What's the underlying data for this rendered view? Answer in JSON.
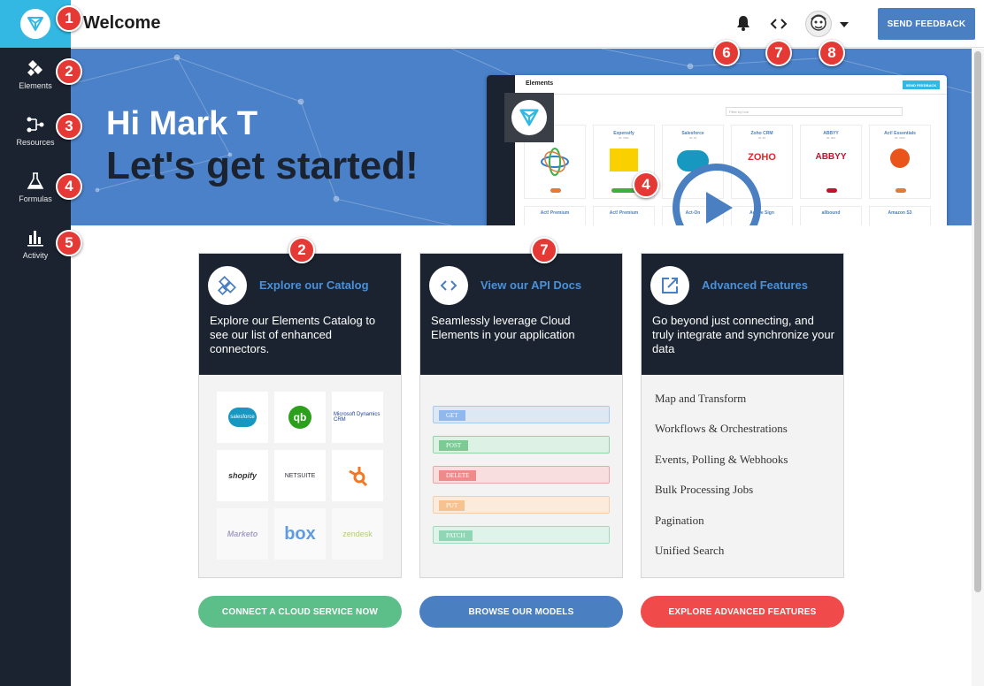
{
  "header": {
    "title": "Welcome",
    "feedback_label": "SEND FEEDBACK"
  },
  "sidebar": {
    "items": [
      {
        "label": "Elements",
        "icon": "elements-icon"
      },
      {
        "label": "Resources",
        "icon": "resources-icon"
      },
      {
        "label": "Formulas",
        "icon": "formulas-icon"
      },
      {
        "label": "Activity",
        "icon": "activity-icon"
      }
    ]
  },
  "hero": {
    "greeting": "Hi Mark T",
    "headline": "Let's get started!",
    "preview": {
      "title": "Elements",
      "feedback": "SEND FEEDBACK",
      "filter_placeholder": "Filter by hub",
      "cards": [
        "Expensify",
        "Salesforce",
        "Zoho CRM",
        "ABBYY",
        "Act! Essentials"
      ],
      "cards_row2": [
        "Act! Premium",
        "Act! Premium",
        "Act-On",
        "Adobe Sign",
        "allbound",
        "Amazon S3"
      ]
    }
  },
  "badges": [
    "1",
    "2",
    "3",
    "4",
    "5",
    "6",
    "7",
    "8",
    "2",
    "7",
    "4"
  ],
  "cards": [
    {
      "title": "Explore our Catalog",
      "description": "Explore our Elements Catalog to see our list of enhanced connectors.",
      "logos": [
        "salesforce",
        "qb",
        "Microsoft Dynamics CRM",
        "shopify",
        "NETSUITE",
        "hubspot",
        "Marketo",
        "box",
        "zendesk"
      ]
    },
    {
      "title": "View our API Docs",
      "description": "Seamlessly leverage Cloud Elements in your application",
      "methods": [
        "GET",
        "POST",
        "DELETE",
        "PUT",
        "PATCH"
      ]
    },
    {
      "title": "Advanced Features",
      "description": "Go beyond just connecting, and truly integrate and synchronize your data",
      "features": [
        "Map and Transform",
        "Workflows & Orchestrations",
        "Events, Polling & Webhooks",
        "Bulk Processing Jobs",
        "Pagination",
        "Unified Search"
      ]
    }
  ],
  "ctas": [
    "CONNECT A CLOUD SERVICE NOW",
    "BROWSE OUR MODELS",
    "EXPLORE ADVANCED FEATURES"
  ],
  "colors": {
    "sidebar": "#1b2330",
    "accent": "#33b8e4",
    "hero": "#4a81c9",
    "badge": "#e53935",
    "cta_green": "#5cbf8a",
    "cta_blue": "#4a7fc1",
    "cta_red": "#f04a4a"
  }
}
